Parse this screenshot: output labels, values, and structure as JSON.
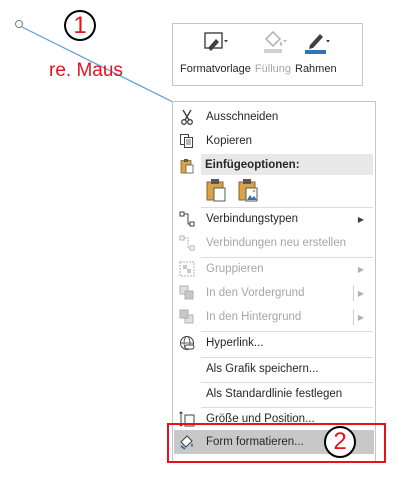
{
  "annotations": {
    "step1": "1",
    "step1_caption": "re. Maus",
    "step2": "2",
    "color": "#e8121b"
  },
  "toolbar": {
    "buttons": [
      {
        "label": "Formatvorlage",
        "icon": "shape-style-icon",
        "enabled": true
      },
      {
        "label": "Füllung",
        "icon": "fill-bucket-icon",
        "enabled": false
      },
      {
        "label": "Rahmen",
        "icon": "pen-outline-icon",
        "enabled": true
      }
    ]
  },
  "menu": {
    "paste_header": "Einfügeoptionen:",
    "items": [
      {
        "label": "Ausschneiden",
        "icon": "scissors-icon",
        "enabled": true
      },
      {
        "label": "Kopieren",
        "icon": "copy-icon",
        "enabled": true
      },
      {
        "label": "Verbindungstypen",
        "icon": "connector-type-icon",
        "enabled": true,
        "submenu": true
      },
      {
        "label": "Verbindungen neu erstellen",
        "icon": "reroute-connector-icon",
        "enabled": false
      },
      {
        "label": "Gruppieren",
        "icon": "group-icon",
        "enabled": false,
        "submenu": true
      },
      {
        "label": "In den Vordergrund",
        "icon": "bring-forward-icon",
        "enabled": false,
        "submenu": true
      },
      {
        "label": "In den Hintergrund",
        "icon": "send-backward-icon",
        "enabled": false,
        "submenu": true
      },
      {
        "label": "Hyperlink...",
        "icon": "hyperlink-icon",
        "enabled": true
      },
      {
        "label": "Als Grafik speichern...",
        "icon": "",
        "enabled": true
      },
      {
        "label": "Als Standardlinie festlegen",
        "icon": "",
        "enabled": true
      },
      {
        "label": "Größe und Position...",
        "icon": "size-position-icon",
        "enabled": true
      },
      {
        "label": "Form formatieren...",
        "icon": "format-shape-icon",
        "enabled": true,
        "selected": true
      }
    ]
  }
}
